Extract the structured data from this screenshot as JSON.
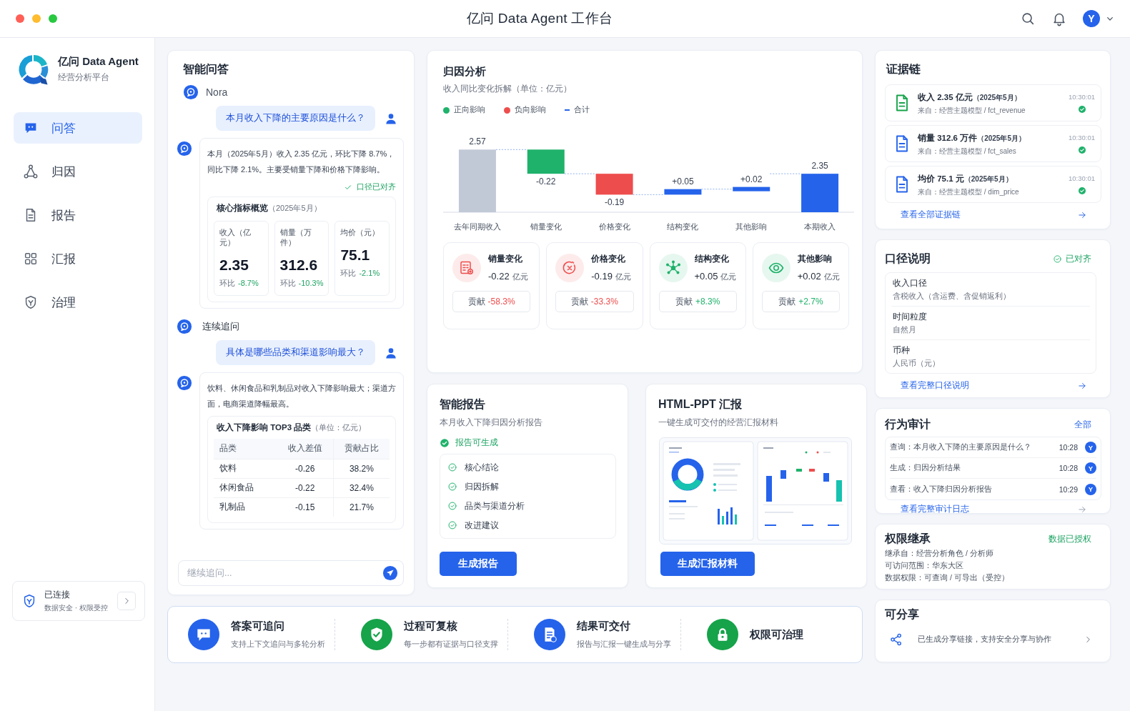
{
  "window": {
    "title": "亿问 Data Agent 工作台",
    "user_initial": "Y"
  },
  "brand": {
    "name": "亿问 Data Agent",
    "subtitle": "经营分析平台"
  },
  "nav": [
    {
      "label": "问答",
      "selected": true
    },
    {
      "label": "归因",
      "selected": false
    },
    {
      "label": "报告",
      "selected": false
    },
    {
      "label": "汇报",
      "selected": false
    },
    {
      "label": "治理",
      "selected": false
    }
  ],
  "connection": {
    "title": "已连接",
    "subtitle": "数据安全 · 权限受控"
  },
  "qa": {
    "title": "智能问答",
    "agent": "Nora",
    "thread": [
      {
        "kind": "user",
        "text": "本月收入下降的主要原因是什么？"
      },
      {
        "kind": "answer",
        "text": "本月（2025年5月）收入 2.35 亿元，环比下降 8.7%，同比下降 2.1%。主要受销量下降和价格下降影响。",
        "badge": "口径已对齐",
        "metrics": {
          "title": "核心指标概览",
          "period": "（2025年5月）",
          "items": [
            {
              "label": "收入（亿元）",
              "value": "2.35",
              "change_label": "环比",
              "change": "-8.7%"
            },
            {
              "label": "销量（万件）",
              "value": "312.6",
              "change_label": "环比",
              "change": "-10.3%"
            },
            {
              "label": "均价（元）",
              "value": "75.1",
              "change_label": "环比",
              "change": "-2.1%"
            }
          ]
        }
      },
      {
        "kind": "heading",
        "text": "连续追问"
      },
      {
        "kind": "user",
        "text": "具体是哪些品类和渠道影响最大？"
      },
      {
        "kind": "answer",
        "text": "饮料、休闲食品和乳制品对收入下降影响最大；渠道方面，电商渠道降幅最高。",
        "table": {
          "title": "收入下降影响 TOP3 品类",
          "unit": "（单位：亿元）",
          "columns": [
            "品类",
            "收入差值",
            "贡献占比"
          ],
          "rows": [
            [
              "饮料",
              "-0.26",
              "38.2%"
            ],
            [
              "休闲食品",
              "-0.22",
              "32.4%"
            ],
            [
              "乳制品",
              "-0.15",
              "21.7%"
            ]
          ]
        }
      }
    ],
    "input": {
      "placeholder": "继续追问..."
    }
  },
  "attribution": {
    "title": "归因分析",
    "subtitle": "收入同比变化拆解（单位：亿元）",
    "legend": [
      {
        "label": "正向影响",
        "color": "#1fb26b",
        "kind": "dot"
      },
      {
        "label": "负向影响",
        "color": "#ee4d4d",
        "kind": "dot"
      },
      {
        "label": "合计",
        "color": "#2563eb",
        "kind": "dash"
      }
    ],
    "waterfall": {
      "bars": [
        {
          "category": "去年同期收入",
          "label": "2.57",
          "color": "#c2c9d6",
          "kind": "total"
        },
        {
          "category": "销量变化",
          "label": "-0.22",
          "color": "#1fb26b",
          "kind": "change"
        },
        {
          "category": "价格变化",
          "label": "-0.19",
          "color": "#ee4d4d",
          "kind": "change"
        },
        {
          "category": "结构变化",
          "label": "+0.05",
          "color": "#2563eb",
          "kind": "change"
        },
        {
          "category": "其他影响",
          "label": "+0.02",
          "color": "#2563eb",
          "kind": "change"
        },
        {
          "category": "本期收入",
          "label": "2.35",
          "color": "#2563eb",
          "kind": "total"
        }
      ]
    },
    "factors": [
      {
        "name": "销量变化",
        "value": "-0.22",
        "unit": "亿元",
        "share_label": "贡献",
        "share": "-58.3%",
        "color": "#ee4d4d"
      },
      {
        "name": "价格变化",
        "value": "-0.19",
        "unit": "亿元",
        "share_label": "贡献",
        "share": "-33.3%",
        "color": "#ee4d4d"
      },
      {
        "name": "结构变化",
        "value": "+0.05",
        "unit": "亿元",
        "share_label": "贡献",
        "share": "+8.3%",
        "color": "#1fb26b"
      },
      {
        "name": "其他影响",
        "value": "+0.02",
        "unit": "亿元",
        "share_label": "贡献",
        "share": "+2.7%",
        "color": "#1fb26b"
      }
    ]
  },
  "report": {
    "title": "智能报告",
    "subtitle": "本月收入下降归因分析报告",
    "status": "报告可生成",
    "ready": true,
    "sections": [
      {
        "label": "核心结论",
        "done": true
      },
      {
        "label": "归因拆解",
        "done": true
      },
      {
        "label": "品类与渠道分析",
        "done": true
      },
      {
        "label": "改进建议",
        "done": true
      }
    ],
    "button": "生成报告"
  },
  "ppt": {
    "title": "HTML-PPT 汇报",
    "subtitle": "一键生成可交付的经营汇报材料",
    "button": "生成汇报材料"
  },
  "features": [
    {
      "color": "#2563eb",
      "title": "答案可追问",
      "desc": "支持上下文追问与多轮分析"
    },
    {
      "color": "#16a34a",
      "title": "过程可复核",
      "desc": "每一步都有证据与口径支撑"
    },
    {
      "color": "#2563eb",
      "title": "结果可交付",
      "desc": "报告与汇报一键生成与分享"
    },
    {
      "color": "#16a34a",
      "title": "权限可治理"
    }
  ],
  "evidence": {
    "title": "证据链",
    "items": [
      {
        "title": "收入 2.35 亿元",
        "period": "（2025年5月）",
        "source": "来自：经营主题模型 / fct_revenue",
        "time": "10:30:01",
        "verified": true,
        "color": "#16a34a"
      },
      {
        "title": "销量 312.6 万件",
        "period": "（2025年5月）",
        "source": "来自：经营主题模型 / fct_sales",
        "time": "10:30:01",
        "verified": true,
        "color": "#2563eb"
      },
      {
        "title": "均价 75.1 元",
        "period": "（2025年5月）",
        "source": "来自：经营主题模型 / dim_price",
        "time": "10:30:01",
        "verified": true,
        "color": "#2563eb"
      }
    ],
    "link": "查看全部证据链"
  },
  "definitions": {
    "title": "口径说明",
    "status": "已对齐",
    "aligned": true,
    "items": [
      {
        "label": "收入口径",
        "value": "含税收入（含运费、含促销返利）"
      },
      {
        "label": "时间粒度",
        "value": "自然月"
      },
      {
        "label": "币种",
        "value": "人民币（元）"
      }
    ],
    "link": "查看完整口径说明"
  },
  "audit": {
    "title": "行为审计",
    "all": "全部",
    "entries": [
      {
        "text": "查询：本月收入下降的主要原因是什么？",
        "time": "10:28",
        "user": "Y"
      },
      {
        "text": "生成：归因分析结果",
        "time": "10:28",
        "user": "Y"
      },
      {
        "text": "查看：收入下降归因分析报告",
        "time": "10:29",
        "user": "Y"
      }
    ],
    "link": "查看完整审计日志"
  },
  "permission": {
    "title": "权限继承",
    "status": "数据已授权",
    "lines": [
      "继承自：经营分析角色 / 分析师",
      "可访问范围：华东大区",
      "数据权限：可查询 / 可导出（受控）"
    ]
  },
  "share": {
    "title": "可分享",
    "text": "已生成分享链接，支持安全分享与协作"
  }
}
